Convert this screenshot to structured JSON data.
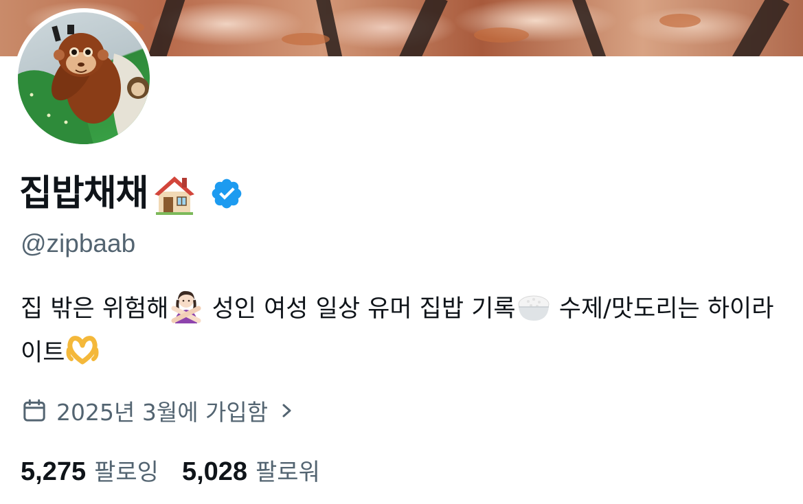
{
  "profile": {
    "display_name": "집밥채채",
    "name_emoji": "house-icon",
    "verified_badge": "verified-icon",
    "handle": "@zipbaab",
    "bio": {
      "part1": "집 밖은 위험해",
      "part2": " 성인 여성 일상 유머 집밥 기록",
      "part3": " 수제/맛도리는 하이라이트",
      "emojis": [
        "person-gesturing-no-icon",
        "rice-bowl-icon",
        "heart-hands-icon"
      ]
    },
    "joined": {
      "text": "2025년 3월에 가입함",
      "icon": "calendar-icon"
    },
    "stats": {
      "following_count": "5,275",
      "following_label": "팔로잉",
      "followers_count": "5,028",
      "followers_label": "팔로워"
    }
  },
  "colors": {
    "primary_text": "#0f1419",
    "secondary_text": "#536471",
    "verified_blue": "#1d9bf0"
  }
}
